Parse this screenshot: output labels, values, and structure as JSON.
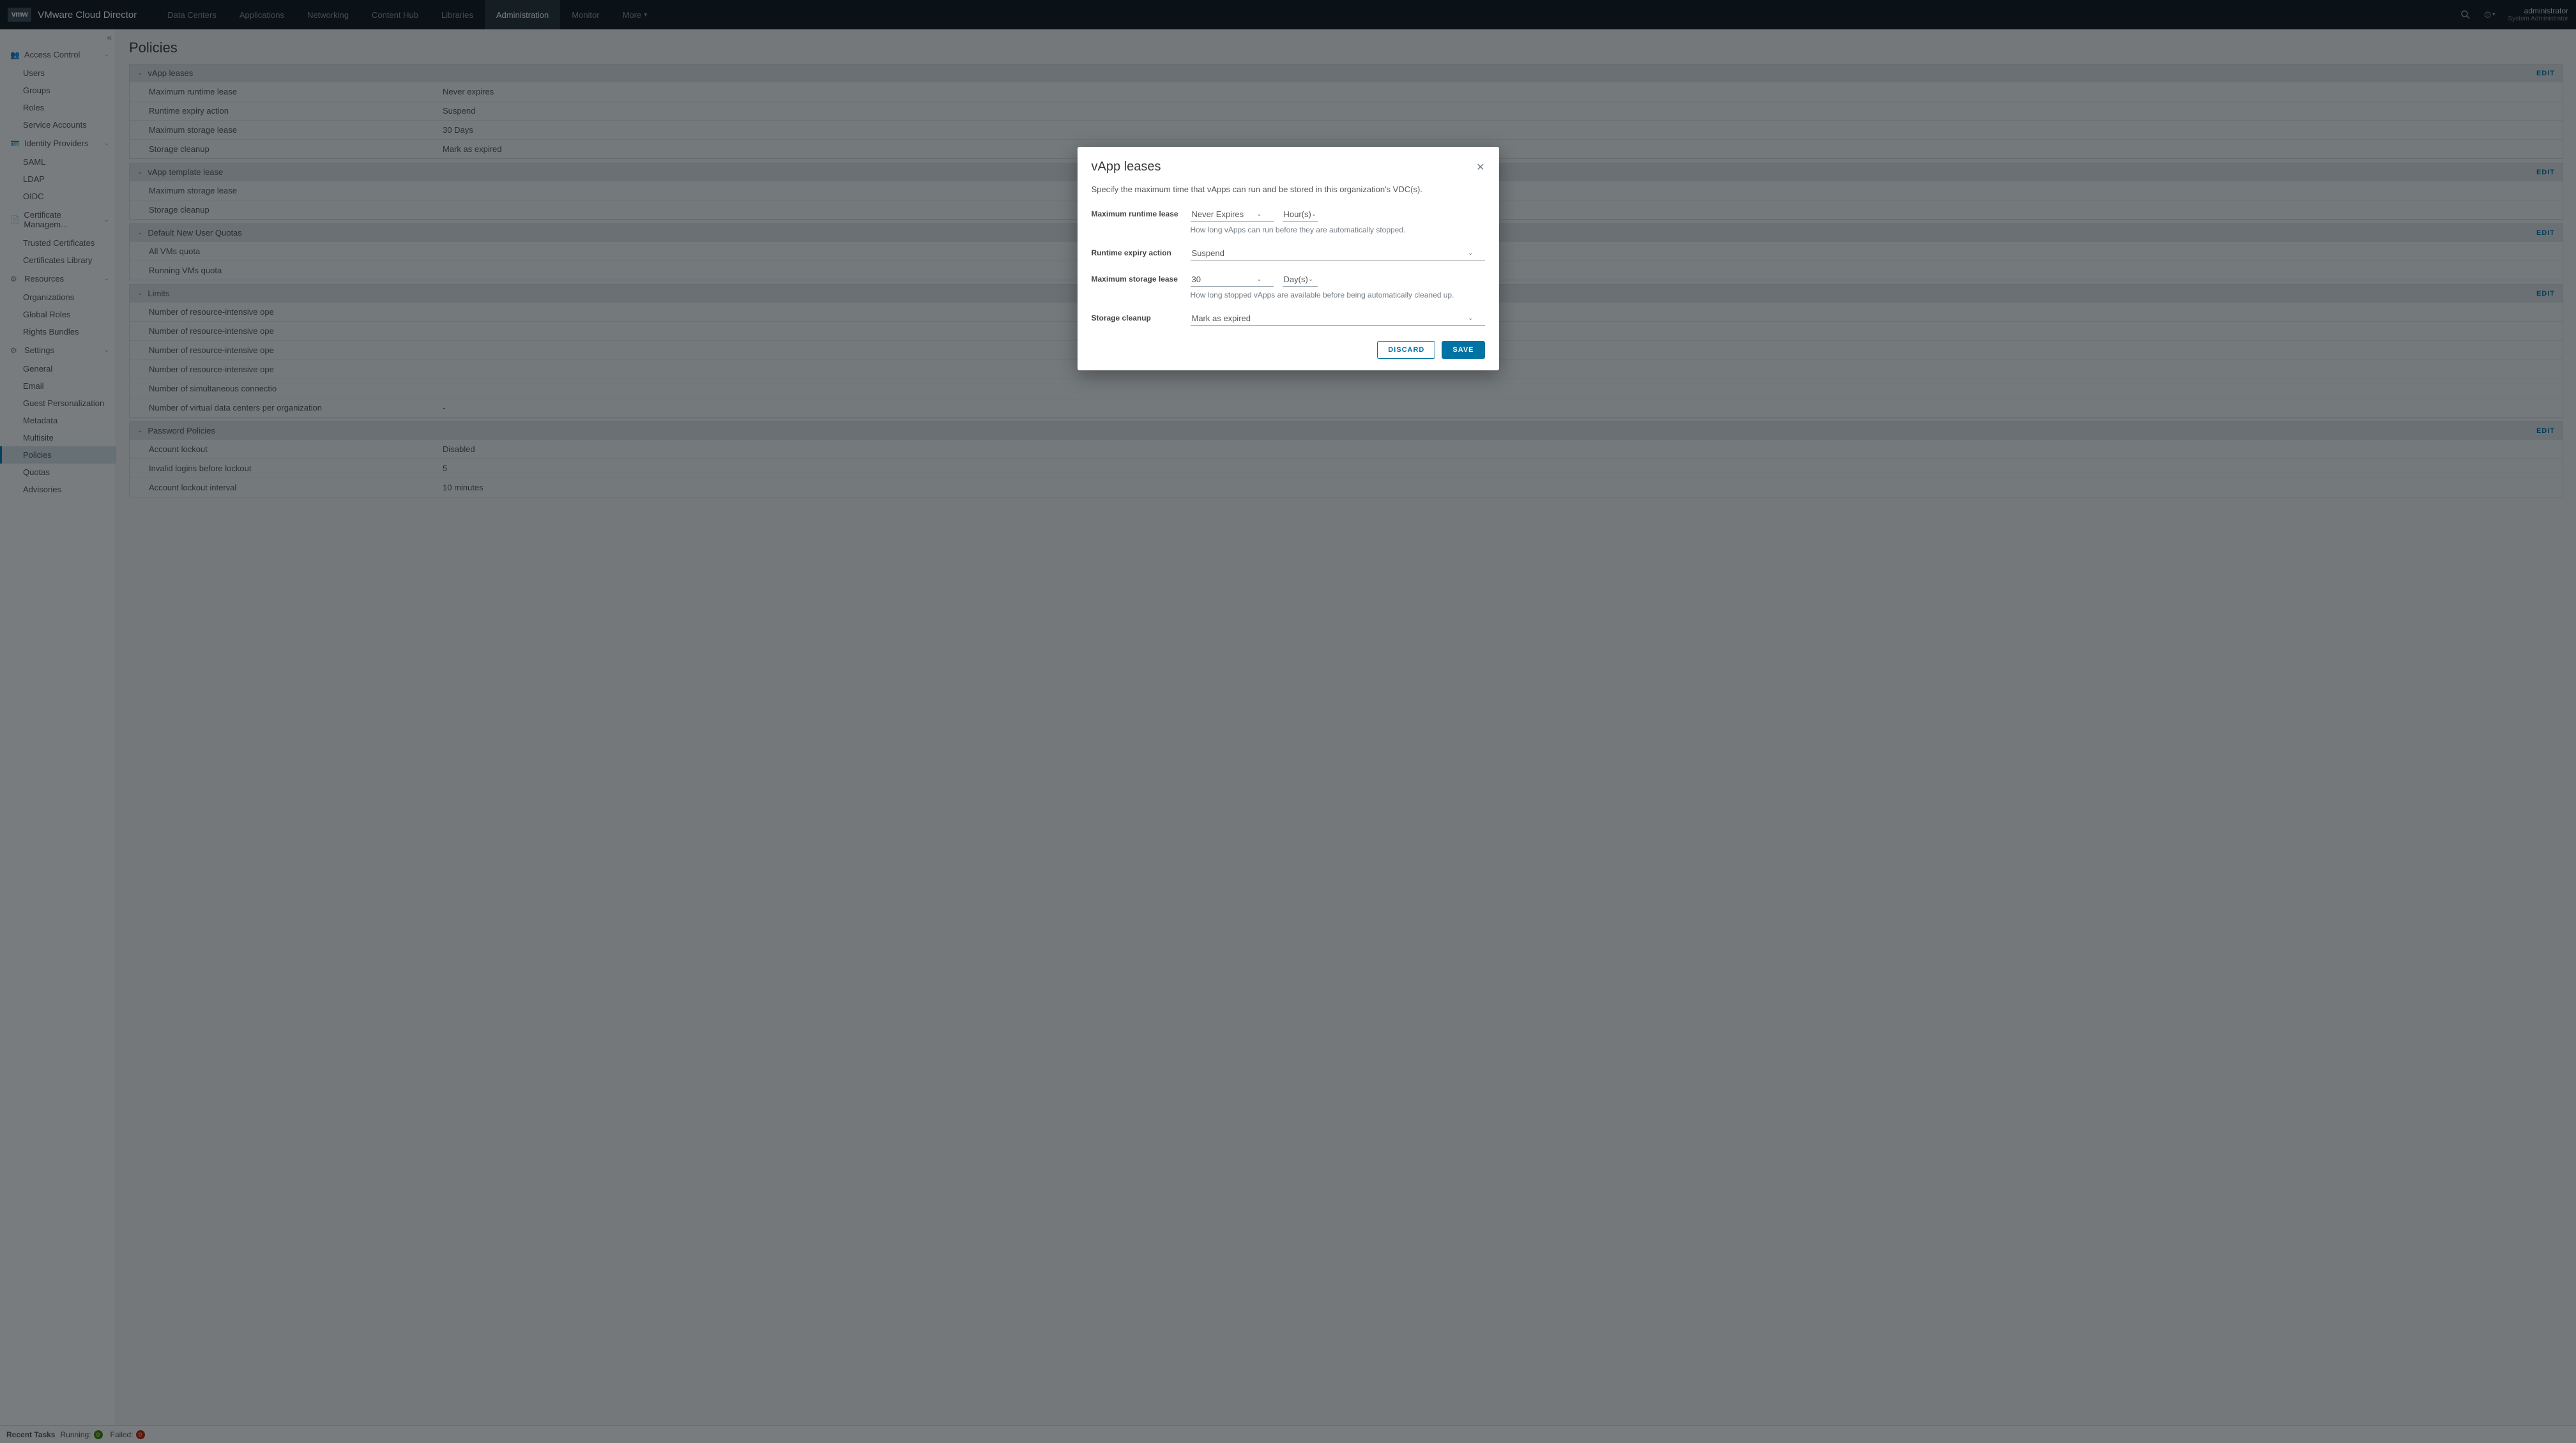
{
  "brand": {
    "logo": "vmw",
    "title": "VMware Cloud Director"
  },
  "nav": {
    "items": [
      "Data Centers",
      "Applications",
      "Networking",
      "Content Hub",
      "Libraries",
      "Administration",
      "Monitor"
    ],
    "more": "More",
    "active_index": 5
  },
  "user": {
    "name": "administrator",
    "role": "System Administrator"
  },
  "sidebar": {
    "sections": [
      {
        "title": "Access Control",
        "items": [
          "Users",
          "Groups",
          "Roles",
          "Service Accounts"
        ]
      },
      {
        "title": "Identity Providers",
        "items": [
          "SAML",
          "LDAP",
          "OIDC"
        ]
      },
      {
        "title": "Certificate Managem...",
        "items": [
          "Trusted Certificates",
          "Certificates Library"
        ]
      },
      {
        "title": "Resources",
        "items": [
          "Organizations",
          "Global Roles",
          "Rights Bundles"
        ]
      },
      {
        "title": "Settings",
        "items": [
          "General",
          "Email",
          "Guest Personalization",
          "Metadata",
          "Multisite",
          "Policies",
          "Quotas",
          "Advisories"
        ]
      }
    ],
    "active": "Policies"
  },
  "page": {
    "title": "Policies",
    "edit": "EDIT"
  },
  "policies": [
    {
      "title": "vApp leases",
      "rows": [
        {
          "label": "Maximum runtime lease",
          "value": "Never expires"
        },
        {
          "label": "Runtime expiry action",
          "value": "Suspend"
        },
        {
          "label": "Maximum storage lease",
          "value": "30 Days"
        },
        {
          "label": "Storage cleanup",
          "value": "Mark as expired"
        }
      ]
    },
    {
      "title": "vApp template lease",
      "rows": [
        {
          "label": "Maximum storage lease",
          "value": ""
        },
        {
          "label": "Storage cleanup",
          "value": ""
        }
      ]
    },
    {
      "title": "Default New User Quotas",
      "rows": [
        {
          "label": "All VMs quota",
          "value": ""
        },
        {
          "label": "Running VMs quota",
          "value": ""
        }
      ]
    },
    {
      "title": "Limits",
      "rows": [
        {
          "label": "Number of resource-intensive ope",
          "value": ""
        },
        {
          "label": "Number of resource-intensive ope",
          "value": ""
        },
        {
          "label": "Number of resource-intensive ope",
          "value": ""
        },
        {
          "label": "Number of resource-intensive ope",
          "value": ""
        },
        {
          "label": "Number of simultaneous connectio",
          "value": ""
        },
        {
          "label": "Number of virtual data centers per organization",
          "value": "-"
        }
      ]
    },
    {
      "title": "Password Policies",
      "rows": [
        {
          "label": "Account lockout",
          "value": "Disabled"
        },
        {
          "label": "Invalid logins before lockout",
          "value": "5"
        },
        {
          "label": "Account lockout interval",
          "value": "10 minutes"
        }
      ]
    }
  ],
  "footer": {
    "recent": "Recent Tasks",
    "running": "Running:",
    "running_n": "0",
    "failed": "Failed:",
    "failed_n": "0"
  },
  "modal": {
    "title": "vApp leases",
    "desc": "Specify the maximum time that vApps can run and be stored in this organization's VDC(s).",
    "fields": {
      "runtime_label": "Maximum runtime lease",
      "runtime_value": "Never Expires",
      "runtime_unit": "Hour(s)",
      "runtime_hint": "How long vApps can run before they are automatically stopped.",
      "expiry_label": "Runtime expiry action",
      "expiry_value": "Suspend",
      "storage_label": "Maximum storage lease",
      "storage_value": "30",
      "storage_unit": "Day(s)",
      "storage_hint": "How long stopped vApps are available before being automatically cleaned up.",
      "cleanup_label": "Storage cleanup",
      "cleanup_value": "Mark as expired"
    },
    "discard": "DISCARD",
    "save": "SAVE"
  }
}
